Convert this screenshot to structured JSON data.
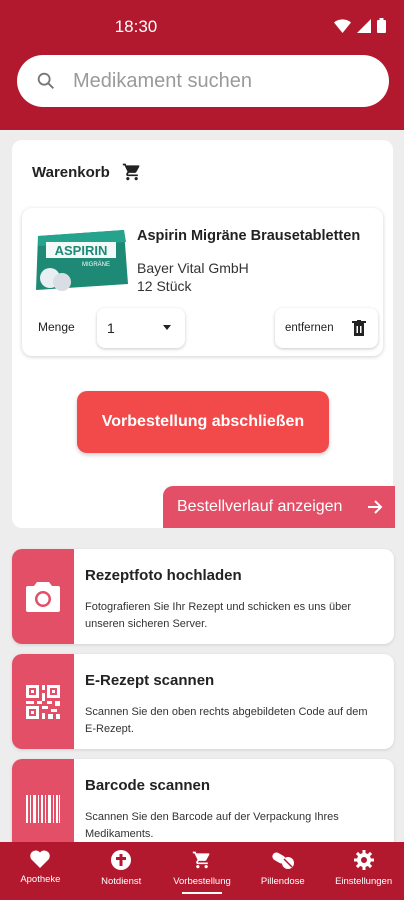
{
  "status": {
    "time": "18:30"
  },
  "search": {
    "placeholder": "Medikament suchen"
  },
  "cart": {
    "title": "Warenkorb",
    "product": {
      "name": "Aspirin Migräne Brausetabletten",
      "maker": "Bayer Vital GmbH",
      "quantity_text": "12 Stück",
      "image_brand": "ASPIRIN",
      "image_sub": "MIGRÄNE"
    },
    "menge_label": "Menge",
    "menge_value": "1",
    "remove_label": "entfernen",
    "checkout_label": "Vorbestellung abschließen",
    "history_label": "Bestellverlauf anzeigen"
  },
  "actions": [
    {
      "title": "Rezeptfoto hochladen",
      "desc": "Fotografieren Sie Ihr Rezept und schicken es uns über unseren sicheren Server.",
      "icon": "camera-icon"
    },
    {
      "title": "E-Rezept scannen",
      "desc": "Scannen Sie den oben rechts abgebildeten Code auf dem E-Rezept.",
      "icon": "qr-code-icon"
    },
    {
      "title": "Barcode scannen",
      "desc": "Scannen Sie den Barcode auf der Verpackung Ihres Medikaments.",
      "icon": "barcode-icon"
    }
  ],
  "nav": [
    {
      "label": "Apotheke",
      "icon": "heart-icon"
    },
    {
      "label": "Notdienst",
      "icon": "emergency-icon"
    },
    {
      "label": "Vorbestellung",
      "icon": "cart-icon",
      "active": true
    },
    {
      "label": "Pillendose",
      "icon": "pills-icon"
    },
    {
      "label": "Einstellungen",
      "icon": "gear-icon"
    }
  ],
  "colors": {
    "primary": "#b3192e",
    "accent": "#e24f67",
    "cta": "#f24a4a",
    "background": "#ededed"
  }
}
